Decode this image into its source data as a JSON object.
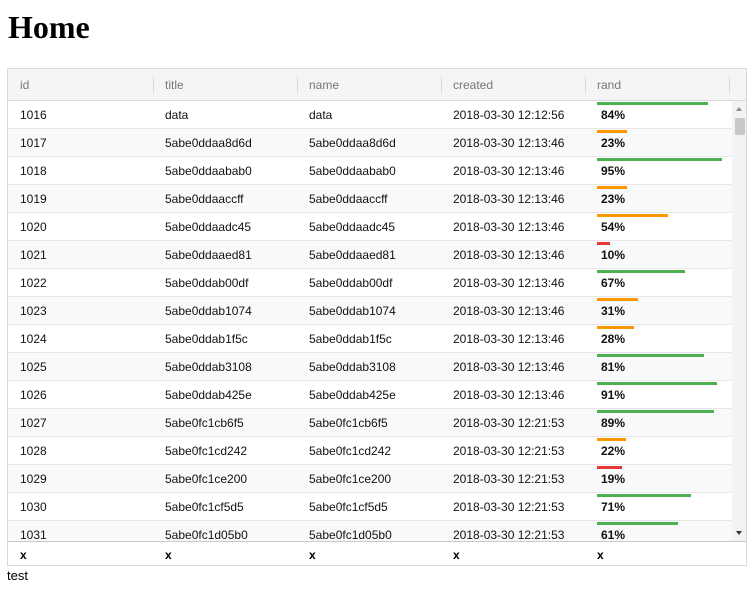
{
  "page": {
    "title": "Home",
    "caption": "test"
  },
  "columns": [
    "id",
    "title",
    "name",
    "created",
    "rand"
  ],
  "footer": [
    "x",
    "x",
    "x",
    "x",
    "x"
  ],
  "colors": {
    "high": "#4caf50",
    "mid": "#ff9800",
    "low": "#e53935"
  },
  "rows": [
    {
      "id": "1016",
      "title": "data",
      "name": "data",
      "created": "2018-03-30 12:12:56",
      "rand": "84%",
      "rand_value": 0.84,
      "level": "high"
    },
    {
      "id": "1017",
      "title": "5abe0ddaa8d6d",
      "name": "5abe0ddaa8d6d",
      "created": "2018-03-30 12:13:46",
      "rand": "23%",
      "rand_value": 0.23,
      "level": "mid"
    },
    {
      "id": "1018",
      "title": "5abe0ddaabab0",
      "name": "5abe0ddaabab0",
      "created": "2018-03-30 12:13:46",
      "rand": "95%",
      "rand_value": 0.95,
      "level": "high"
    },
    {
      "id": "1019",
      "title": "5abe0ddaaccff",
      "name": "5abe0ddaaccff",
      "created": "2018-03-30 12:13:46",
      "rand": "23%",
      "rand_value": 0.23,
      "level": "mid"
    },
    {
      "id": "1020",
      "title": "5abe0ddaadc45",
      "name": "5abe0ddaadc45",
      "created": "2018-03-30 12:13:46",
      "rand": "54%",
      "rand_value": 0.54,
      "level": "mid"
    },
    {
      "id": "1021",
      "title": "5abe0ddaaed81",
      "name": "5abe0ddaaed81",
      "created": "2018-03-30 12:13:46",
      "rand": "10%",
      "rand_value": 0.1,
      "level": "low"
    },
    {
      "id": "1022",
      "title": "5abe0ddab00df",
      "name": "5abe0ddab00df",
      "created": "2018-03-30 12:13:46",
      "rand": "67%",
      "rand_value": 0.67,
      "level": "high"
    },
    {
      "id": "1023",
      "title": "5abe0ddab1074",
      "name": "5abe0ddab1074",
      "created": "2018-03-30 12:13:46",
      "rand": "31%",
      "rand_value": 0.31,
      "level": "mid"
    },
    {
      "id": "1024",
      "title": "5abe0ddab1f5c",
      "name": "5abe0ddab1f5c",
      "created": "2018-03-30 12:13:46",
      "rand": "28%",
      "rand_value": 0.28,
      "level": "mid"
    },
    {
      "id": "1025",
      "title": "5abe0ddab3108",
      "name": "5abe0ddab3108",
      "created": "2018-03-30 12:13:46",
      "rand": "81%",
      "rand_value": 0.81,
      "level": "high"
    },
    {
      "id": "1026",
      "title": "5abe0ddab425e",
      "name": "5abe0ddab425e",
      "created": "2018-03-30 12:13:46",
      "rand": "91%",
      "rand_value": 0.91,
      "level": "high"
    },
    {
      "id": "1027",
      "title": "5abe0fc1cb6f5",
      "name": "5abe0fc1cb6f5",
      "created": "2018-03-30 12:21:53",
      "rand": "89%",
      "rand_value": 0.89,
      "level": "high"
    },
    {
      "id": "1028",
      "title": "5abe0fc1cd242",
      "name": "5abe0fc1cd242",
      "created": "2018-03-30 12:21:53",
      "rand": "22%",
      "rand_value": 0.22,
      "level": "mid"
    },
    {
      "id": "1029",
      "title": "5abe0fc1ce200",
      "name": "5abe0fc1ce200",
      "created": "2018-03-30 12:21:53",
      "rand": "19%",
      "rand_value": 0.19,
      "level": "low"
    },
    {
      "id": "1030",
      "title": "5abe0fc1cf5d5",
      "name": "5abe0fc1cf5d5",
      "created": "2018-03-30 12:21:53",
      "rand": "71%",
      "rand_value": 0.71,
      "level": "high"
    },
    {
      "id": "1031",
      "title": "5abe0fc1d05b0",
      "name": "5abe0fc1d05b0",
      "created": "2018-03-30 12:21:53",
      "rand": "61%",
      "rand_value": 0.61,
      "level": "high"
    }
  ]
}
